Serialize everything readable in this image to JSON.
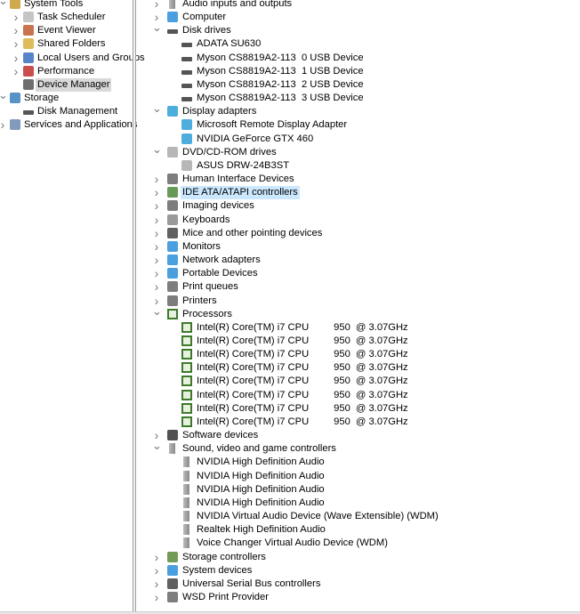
{
  "left_tree": [
    {
      "label": "System Tools",
      "level": 0,
      "state": "expanded",
      "icon": "system-tools-icon"
    },
    {
      "label": "Task Scheduler",
      "level": 1,
      "state": "collapsed",
      "icon": "clock-icon"
    },
    {
      "label": "Event Viewer",
      "level": 1,
      "state": "collapsed",
      "icon": "event-viewer-icon"
    },
    {
      "label": "Shared Folders",
      "level": 1,
      "state": "collapsed",
      "icon": "shared-folder-icon"
    },
    {
      "label": "Local Users and Groups",
      "level": 1,
      "state": "collapsed",
      "icon": "users-icon"
    },
    {
      "label": "Performance",
      "level": 1,
      "state": "collapsed",
      "icon": "performance-icon"
    },
    {
      "label": "Device Manager",
      "level": 1,
      "state": "leaf",
      "icon": "device-manager-icon",
      "selected": true
    },
    {
      "label": "Storage",
      "level": 0,
      "state": "expanded",
      "icon": "storage-icon"
    },
    {
      "label": "Disk Management",
      "level": 1,
      "state": "leaf",
      "icon": "disk-management-icon"
    },
    {
      "label": "Services and Applications",
      "level": 0,
      "state": "collapsed",
      "icon": "services-icon"
    }
  ],
  "device_tree": [
    {
      "label": "Audio inputs and outputs",
      "level": 0,
      "state": "collapsed",
      "icon": "speaker-icon"
    },
    {
      "label": "Computer",
      "level": 0,
      "state": "collapsed",
      "icon": "monitor-icon"
    },
    {
      "label": "Disk drives",
      "level": 0,
      "state": "expanded",
      "icon": "disk-drive-icon"
    },
    {
      "label": "ADATA SU630",
      "level": 1,
      "icon": "disk-drive-icon"
    },
    {
      "label": "Myson CS8819A2-113  0 USB Device",
      "level": 1,
      "icon": "disk-drive-icon"
    },
    {
      "label": "Myson CS8819A2-113  1 USB Device",
      "level": 1,
      "icon": "disk-drive-icon"
    },
    {
      "label": "Myson CS8819A2-113  2 USB Device",
      "level": 1,
      "icon": "disk-drive-icon"
    },
    {
      "label": "Myson CS8819A2-113  3 USB Device",
      "level": 1,
      "icon": "disk-drive-icon"
    },
    {
      "label": "Display adapters",
      "level": 0,
      "state": "expanded",
      "icon": "display-adapter-icon"
    },
    {
      "label": "Microsoft Remote Display Adapter",
      "level": 1,
      "icon": "display-adapter-icon"
    },
    {
      "label": "NVIDIA GeForce GTX 460",
      "level": 1,
      "icon": "display-adapter-icon"
    },
    {
      "label": "DVD/CD-ROM drives",
      "level": 0,
      "state": "expanded",
      "icon": "dvd-icon"
    },
    {
      "label": "ASUS DRW-24B3ST",
      "level": 1,
      "icon": "dvd-icon"
    },
    {
      "label": "Human Interface Devices",
      "level": 0,
      "state": "collapsed",
      "icon": "hid-icon"
    },
    {
      "label": "IDE ATA/ATAPI controllers",
      "level": 0,
      "state": "collapsed",
      "icon": "ide-controller-icon",
      "highlighted": true
    },
    {
      "label": "Imaging devices",
      "level": 0,
      "state": "collapsed",
      "icon": "camera-icon"
    },
    {
      "label": "Keyboards",
      "level": 0,
      "state": "collapsed",
      "icon": "keyboard-icon"
    },
    {
      "label": "Mice and other pointing devices",
      "level": 0,
      "state": "collapsed",
      "icon": "mouse-icon"
    },
    {
      "label": "Monitors",
      "level": 0,
      "state": "collapsed",
      "icon": "monitor-icon"
    },
    {
      "label": "Network adapters",
      "level": 0,
      "state": "collapsed",
      "icon": "network-icon"
    },
    {
      "label": "Portable Devices",
      "level": 0,
      "state": "collapsed",
      "icon": "portable-device-icon"
    },
    {
      "label": "Print queues",
      "level": 0,
      "state": "collapsed",
      "icon": "printer-icon"
    },
    {
      "label": "Printers",
      "level": 0,
      "state": "collapsed",
      "icon": "printer-icon"
    },
    {
      "label": "Processors",
      "level": 0,
      "state": "expanded",
      "icon": "processor-icon"
    },
    {
      "label": "Intel(R) Core(TM) i7 CPU         950  @ 3.07GHz",
      "level": 1,
      "icon": "processor-icon"
    },
    {
      "label": "Intel(R) Core(TM) i7 CPU         950  @ 3.07GHz",
      "level": 1,
      "icon": "processor-icon"
    },
    {
      "label": "Intel(R) Core(TM) i7 CPU         950  @ 3.07GHz",
      "level": 1,
      "icon": "processor-icon"
    },
    {
      "label": "Intel(R) Core(TM) i7 CPU         950  @ 3.07GHz",
      "level": 1,
      "icon": "processor-icon"
    },
    {
      "label": "Intel(R) Core(TM) i7 CPU         950  @ 3.07GHz",
      "level": 1,
      "icon": "processor-icon"
    },
    {
      "label": "Intel(R) Core(TM) i7 CPU         950  @ 3.07GHz",
      "level": 1,
      "icon": "processor-icon"
    },
    {
      "label": "Intel(R) Core(TM) i7 CPU         950  @ 3.07GHz",
      "level": 1,
      "icon": "processor-icon"
    },
    {
      "label": "Intel(R) Core(TM) i7 CPU         950  @ 3.07GHz",
      "level": 1,
      "icon": "processor-icon"
    },
    {
      "label": "Software devices",
      "level": 0,
      "state": "collapsed",
      "icon": "software-device-icon"
    },
    {
      "label": "Sound, video and game controllers",
      "level": 0,
      "state": "expanded",
      "icon": "speaker-icon"
    },
    {
      "label": "NVIDIA High Definition Audio",
      "level": 1,
      "icon": "speaker-icon"
    },
    {
      "label": "NVIDIA High Definition Audio",
      "level": 1,
      "icon": "speaker-icon"
    },
    {
      "label": "NVIDIA High Definition Audio",
      "level": 1,
      "icon": "speaker-icon"
    },
    {
      "label": "NVIDIA High Definition Audio",
      "level": 1,
      "icon": "speaker-icon"
    },
    {
      "label": "NVIDIA Virtual Audio Device (Wave Extensible) (WDM)",
      "level": 1,
      "icon": "speaker-icon"
    },
    {
      "label": "Realtek High Definition Audio",
      "level": 1,
      "icon": "speaker-icon"
    },
    {
      "label": "Voice Changer Virtual Audio Device (WDM)",
      "level": 1,
      "icon": "speaker-icon"
    },
    {
      "label": "Storage controllers",
      "level": 0,
      "state": "collapsed",
      "icon": "storage-controller-icon"
    },
    {
      "label": "System devices",
      "level": 0,
      "state": "collapsed",
      "icon": "system-devices-icon"
    },
    {
      "label": "Universal Serial Bus controllers",
      "level": 0,
      "state": "collapsed",
      "icon": "usb-icon"
    },
    {
      "label": "WSD Print Provider",
      "level": 0,
      "state": "collapsed",
      "icon": "printer-icon"
    }
  ],
  "colors": {
    "selected": "#d9d9d9",
    "highlight": "#cce8ff",
    "accent": "#1e90d6"
  }
}
